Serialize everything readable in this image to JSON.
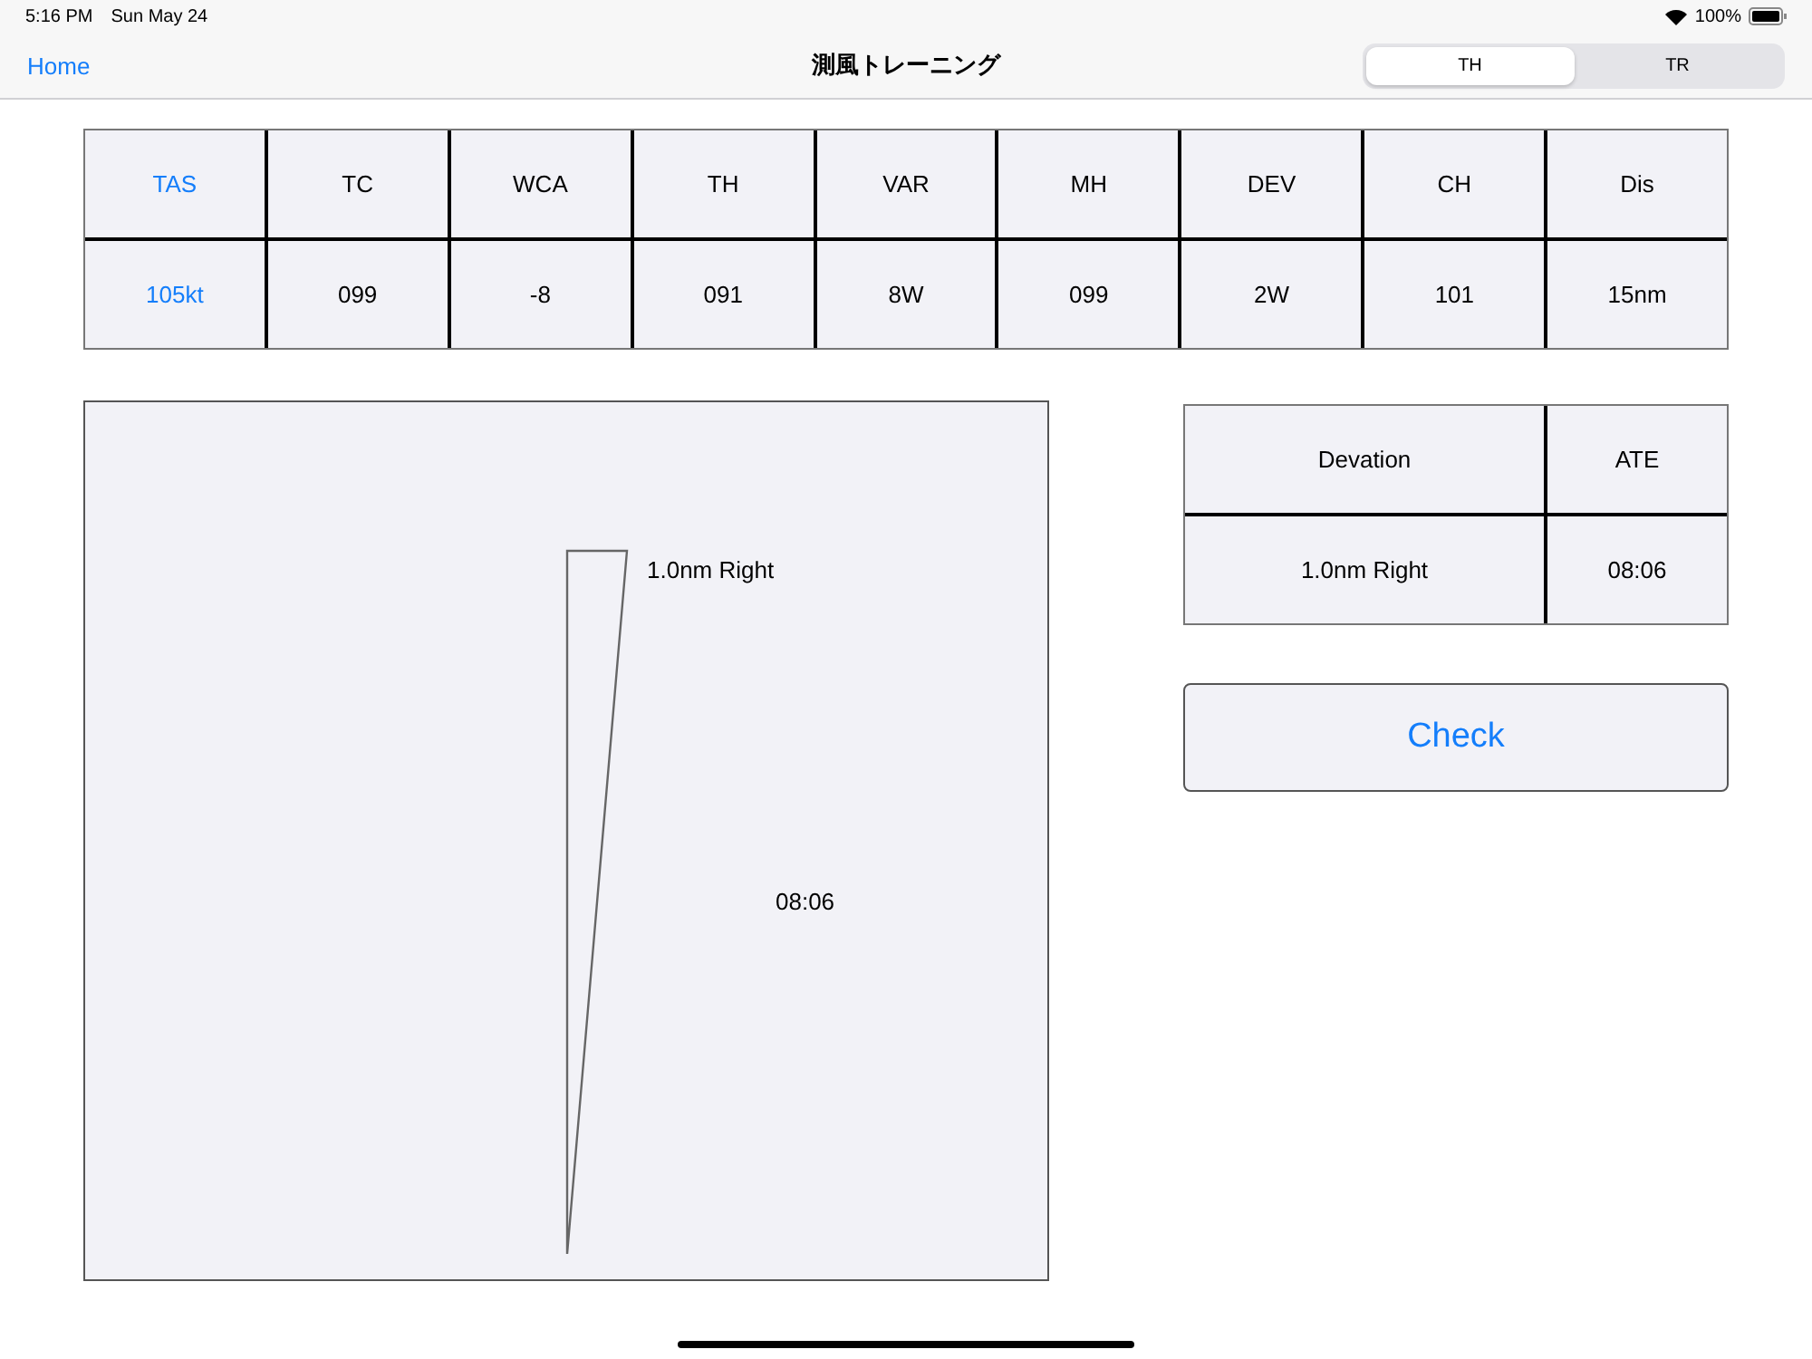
{
  "status_bar": {
    "time": "5:16 PM",
    "date": "Sun May 24",
    "battery": "100%"
  },
  "nav": {
    "back": "Home",
    "title": "測風トレーニング",
    "segments": [
      {
        "label": "TH",
        "selected": true
      },
      {
        "label": "TR",
        "selected": false
      }
    ]
  },
  "log_table": {
    "columns": [
      {
        "label": "TAS",
        "highlight": true
      },
      {
        "label": "TC",
        "highlight": false
      },
      {
        "label": "WCA",
        "highlight": false
      },
      {
        "label": "TH",
        "highlight": false
      },
      {
        "label": "VAR",
        "highlight": false
      },
      {
        "label": "MH",
        "highlight": false
      },
      {
        "label": "DEV",
        "highlight": false
      },
      {
        "label": "CH",
        "highlight": false
      },
      {
        "label": "Dis",
        "highlight": false
      }
    ],
    "values": [
      "105kt",
      "099",
      "-8",
      "091",
      "8W",
      "099",
      "2W",
      "101",
      "15nm"
    ]
  },
  "diagram": {
    "deviation_label": "1.0nm Right",
    "time_label": "08:06"
  },
  "result_table": {
    "columns": [
      "Devation",
      "ATE"
    ],
    "values": [
      "1.0nm Right",
      "08:06"
    ]
  },
  "check_button": "Check"
}
